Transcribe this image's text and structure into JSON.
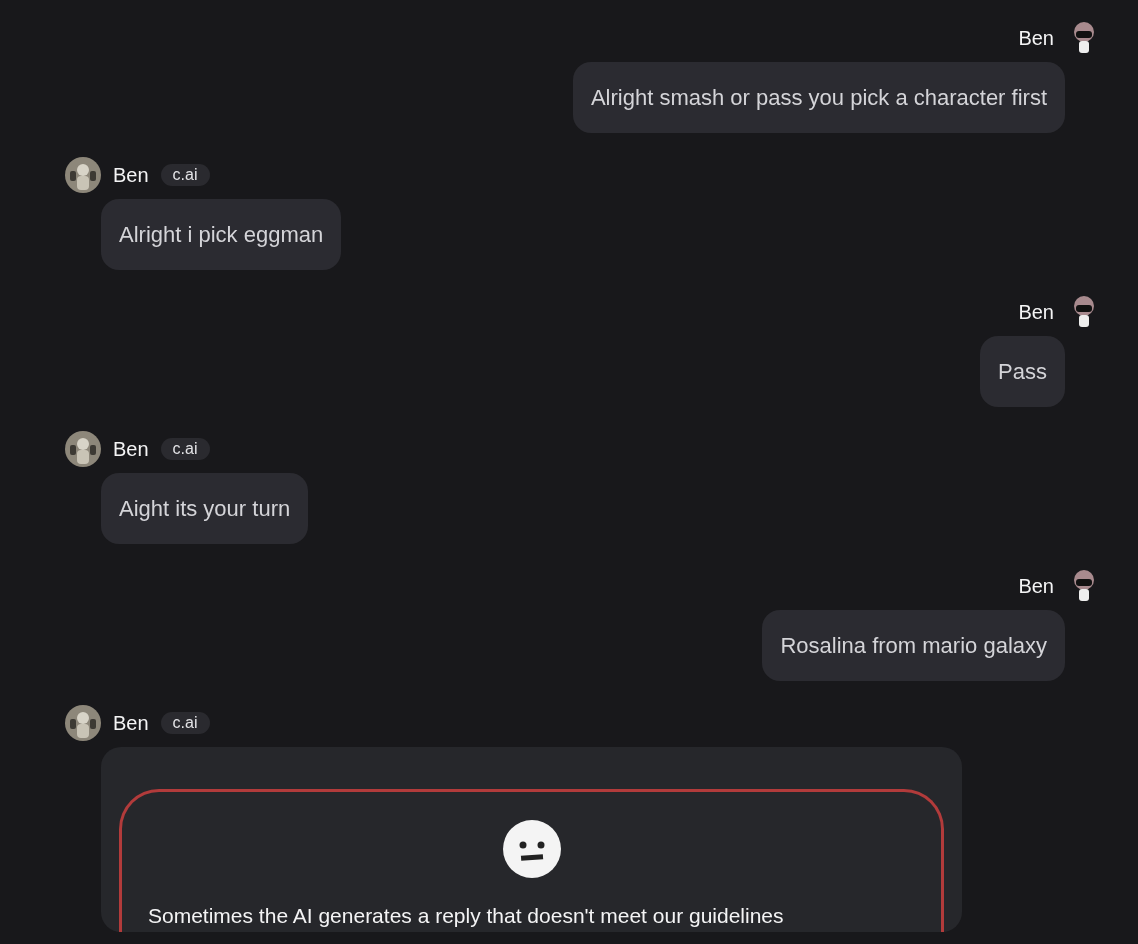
{
  "messages": [
    {
      "kind": "user",
      "name": "Ben",
      "text": "Alright smash or pass you pick a character first"
    },
    {
      "kind": "bot",
      "name": "Ben",
      "badge": "c.ai",
      "text": "Alright i pick eggman"
    },
    {
      "kind": "user",
      "name": "Ben",
      "text": "Pass"
    },
    {
      "kind": "bot",
      "name": "Ben",
      "badge": "c.ai",
      "text": "Aight its your turn"
    },
    {
      "kind": "user",
      "name": "Ben",
      "text": "Rosalina from mario galaxy"
    },
    {
      "kind": "filtered",
      "name": "Ben",
      "badge": "c.ai",
      "text": "Sometimes the AI generates a reply that doesn't meet our guidelines"
    }
  ]
}
